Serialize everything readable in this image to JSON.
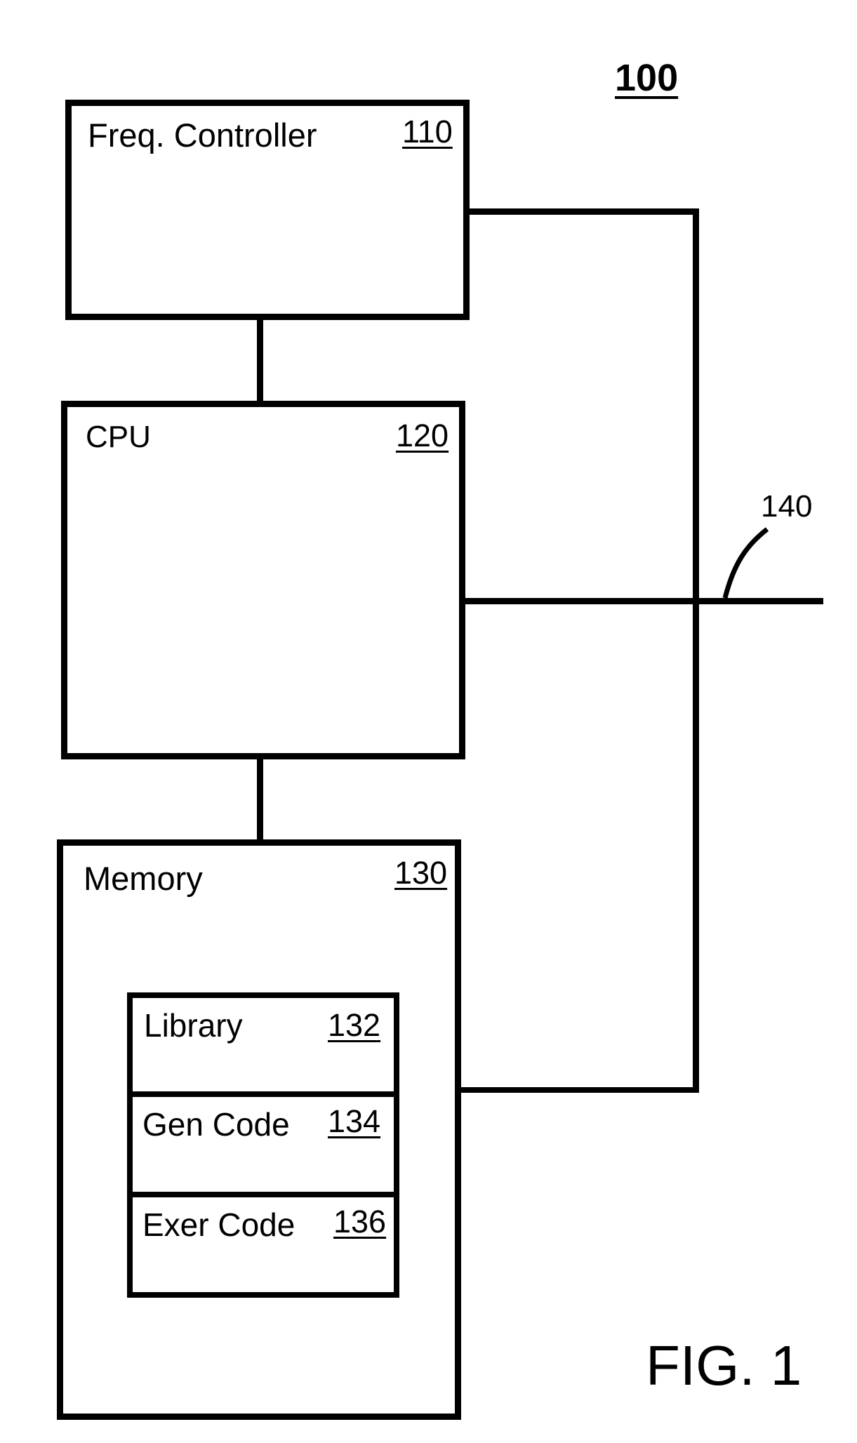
{
  "figure": {
    "number_label": "100",
    "caption": "FIG. 1"
  },
  "blocks": {
    "freq_controller": {
      "title": "Freq. Controller",
      "ref": "110"
    },
    "cpu": {
      "title": "CPU",
      "ref": "120"
    },
    "memory": {
      "title": "Memory",
      "ref": "130",
      "contents": [
        {
          "title": "Library",
          "ref": "132"
        },
        {
          "title": "Gen Code",
          "ref": "134"
        },
        {
          "title": "Exer Code",
          "ref": "136"
        }
      ]
    }
  },
  "bus": {
    "ref": "140"
  },
  "colors": {
    "stroke": "#000000",
    "background": "#ffffff"
  }
}
